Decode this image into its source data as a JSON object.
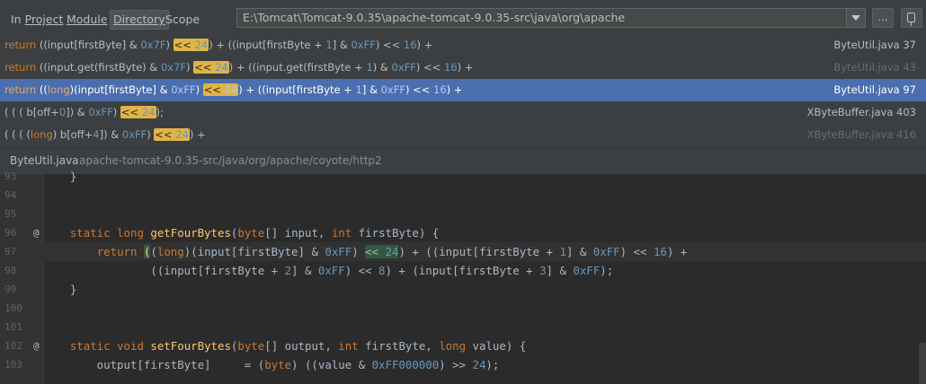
{
  "toolbar": {
    "scopes": [
      {
        "label": "In Project",
        "active": false
      },
      {
        "label": "Module",
        "active": false
      },
      {
        "label": "Directory",
        "active": true
      },
      {
        "label": "Scope",
        "active": false
      }
    ],
    "path": "E:\\Tomcat\\Tomcat-9.0.35\\apache-tomcat-9.0.35-src\\java\\org\\apache",
    "more_label": "...",
    "dropdown_icon": "chevron-down-icon",
    "pin_icon": "pin-icon"
  },
  "results": [
    {
      "text": "return ((input[firstByte] & 0x7F) << 24) + ((input[firstByte + 1] & 0xFF) << 16) +",
      "file": "ByteUtil.java 37",
      "selected": false,
      "dim": false
    },
    {
      "text": "return ((input.get(firstByte) & 0x7F) << 24) + ((input.get(firstByte + 1) & 0xFF) << 16) +",
      "file": "ByteUtil.java 43",
      "selected": false,
      "dim": true
    },
    {
      "text": "return ((long)(input[firstByte] & 0xFF) << 24) + ((input[firstByte + 1] & 0xFF) << 16) +",
      "file": "ByteUtil.java 97",
      "selected": true,
      "dim": false
    },
    {
      "text": "( ( ( b[off+0]) & 0xFF) << 24);",
      "file": "XByteBuffer.java 403",
      "selected": false,
      "dim": false
    },
    {
      "text": "( ( ( (long) b[off+4]) & 0xFF) << 24) +",
      "file": "XByteBuffer.java 416",
      "selected": false,
      "dim": true
    }
  ],
  "preview": {
    "file": "ByteUtil.java",
    "path": "apache-tomcat-9.0.35-src/java/org/apache/coyote/http2"
  },
  "code_lines": [
    {
      "number": "93",
      "annotation": "",
      "text": "    }"
    },
    {
      "number": "94",
      "annotation": "",
      "text": ""
    },
    {
      "number": "95",
      "annotation": "",
      "text": ""
    },
    {
      "number": "96",
      "annotation": "@",
      "text": "    static long getFourBytes(byte[] input, int firstByte) {"
    },
    {
      "number": "97",
      "annotation": "",
      "text": "        return ((long)(input[firstByte] & 0xFF) << 24) + ((input[firstByte + 1] & 0xFF) << 16) +"
    },
    {
      "number": "98",
      "annotation": "",
      "text": "                ((input[firstByte + 2] & 0xFF) << 8) + (input[firstByte + 3] & 0xFF);"
    },
    {
      "number": "99",
      "annotation": "",
      "text": "    }"
    },
    {
      "number": "100",
      "annotation": "",
      "text": ""
    },
    {
      "number": "101",
      "annotation": "",
      "text": ""
    },
    {
      "number": "102",
      "annotation": "@",
      "text": "    static void setFourBytes(byte[] output, int firstByte, long value) {"
    },
    {
      "number": "103",
      "annotation": "",
      "text": "        output[firstByte]     = (byte) ((value & 0xFF000000) >> 24);"
    }
  ]
}
